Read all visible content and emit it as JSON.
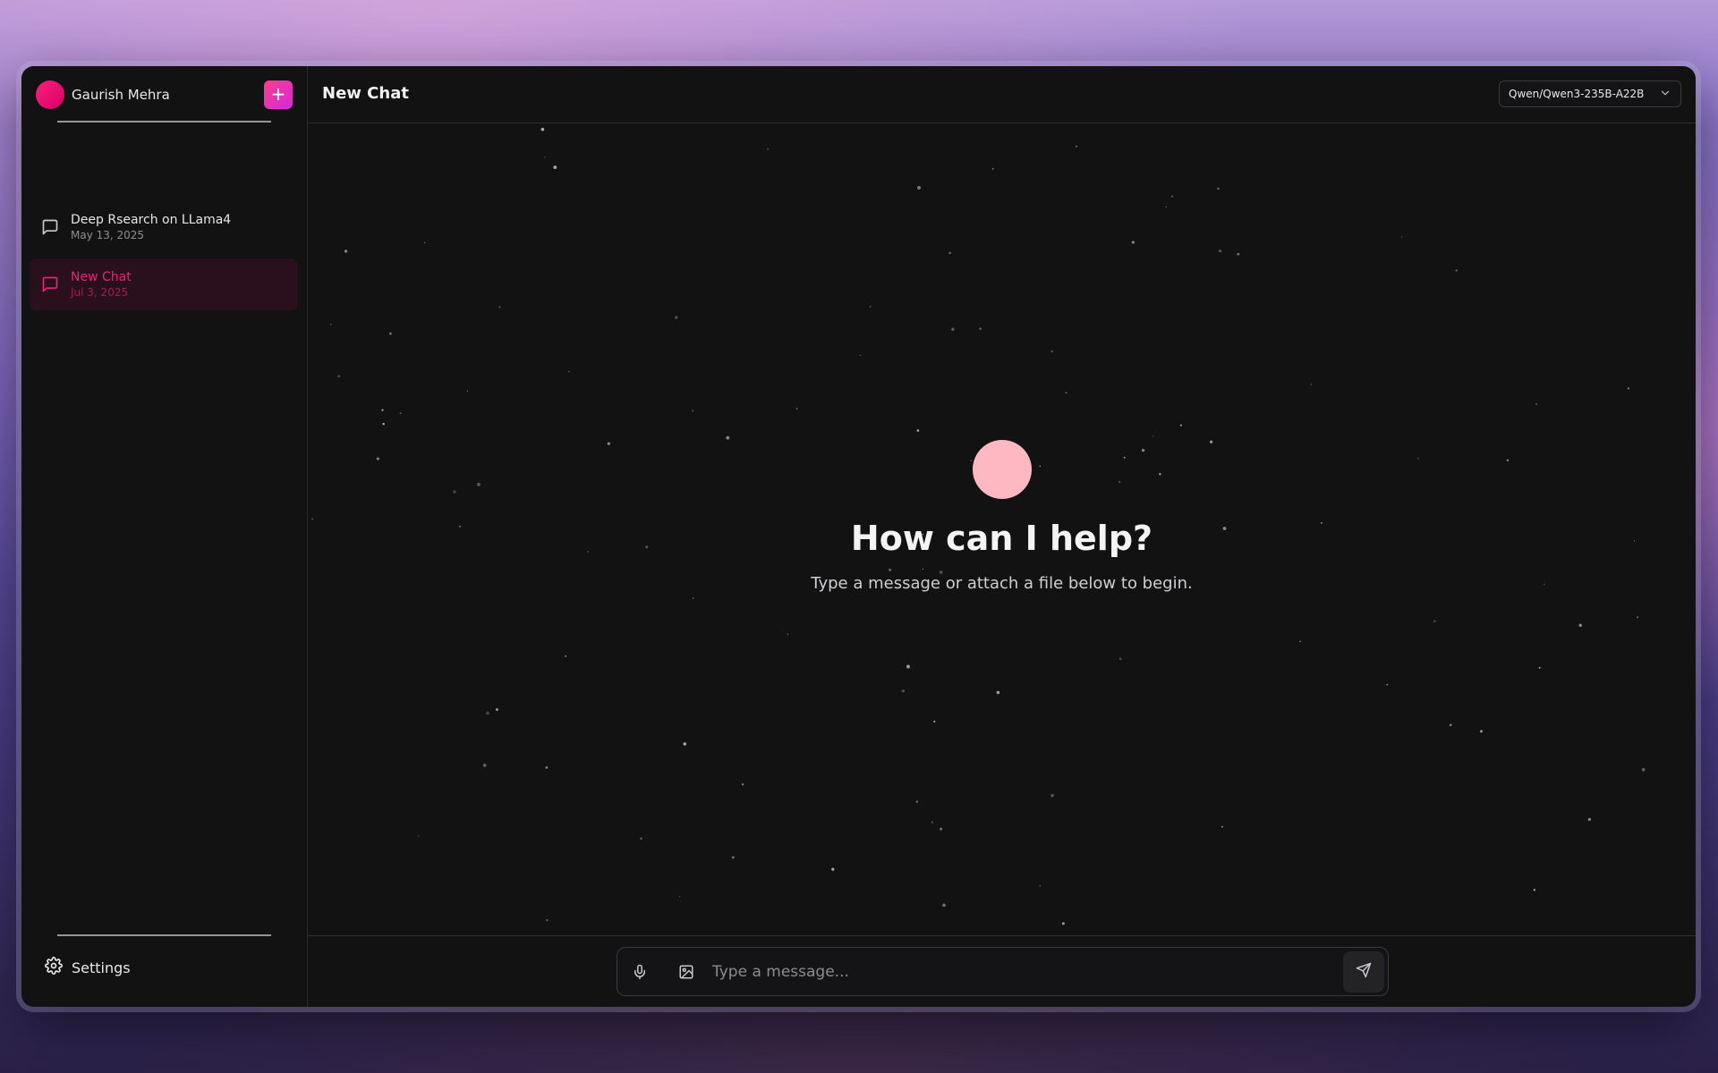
{
  "sidebar": {
    "user_name": "Gaurish Mehra",
    "new_chat_symbol": "+",
    "chats": [
      {
        "title": "Deep Rsearch on LLama4",
        "date": "May 13, 2025",
        "active": false
      },
      {
        "title": "New Chat",
        "date": "Jul 3, 2025",
        "active": true
      }
    ],
    "settings_label": "Settings"
  },
  "header": {
    "title": "New Chat",
    "model": "Qwen/Qwen3-235B-A22B"
  },
  "hero": {
    "title": "How can I help?",
    "subtitle": "Type a message or attach a file below to begin."
  },
  "composer": {
    "placeholder": "Type a message..."
  },
  "icons": {
    "user_avatar": "avatar-circle",
    "new_chat": "plus-icon",
    "chat": "message-square-icon",
    "settings": "gear-icon",
    "model_dropdown": "chevron-down-icon",
    "mic": "microphone-icon",
    "image": "image-icon",
    "send": "send-icon"
  },
  "colors": {
    "accent": "#e0287a",
    "accent_gradient_start": "#ff3c8e",
    "accent_gradient_end": "#d02bd8",
    "hero_dot": "#fdb8c1",
    "panel_bg": "#121213",
    "active_item_bg": "#2a0f1c"
  }
}
